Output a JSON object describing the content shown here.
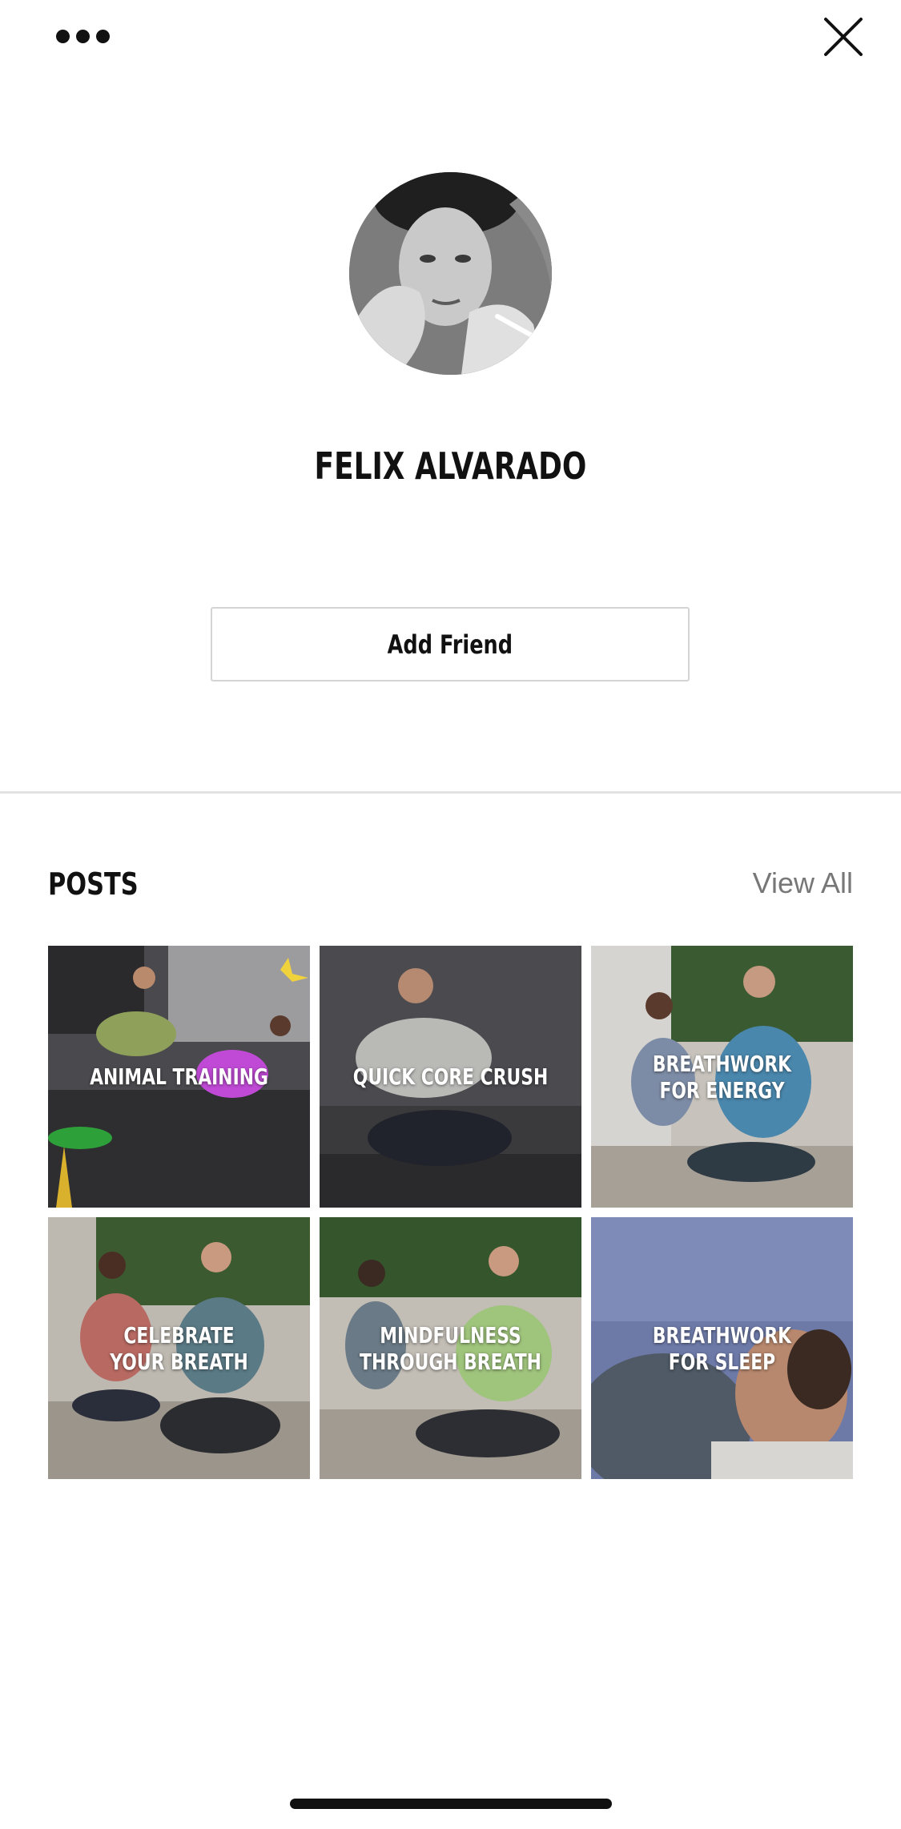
{
  "header": {
    "more_icon": "more-horizontal-icon",
    "close_icon": "close-icon"
  },
  "profile": {
    "name": "FELIX ALVARADO",
    "add_friend_label": "Add Friend"
  },
  "posts": {
    "heading": "POSTS",
    "view_all_label": "View All",
    "items": [
      {
        "title": "ANIMAL TRAINING"
      },
      {
        "title": "QUICK CORE CRUSH"
      },
      {
        "title": "BREATHWORK\nFOR ENERGY"
      },
      {
        "title": "CELEBRATE\nYOUR BREATH"
      },
      {
        "title": "MINDFULNESS\nTHROUGH BREATH"
      },
      {
        "title": "BREATHWORK\nFOR SLEEP"
      }
    ]
  },
  "colors": {
    "text": "#111111",
    "muted": "#777777",
    "divider": "#e2e2e2",
    "button_border": "#d4d4d4"
  }
}
